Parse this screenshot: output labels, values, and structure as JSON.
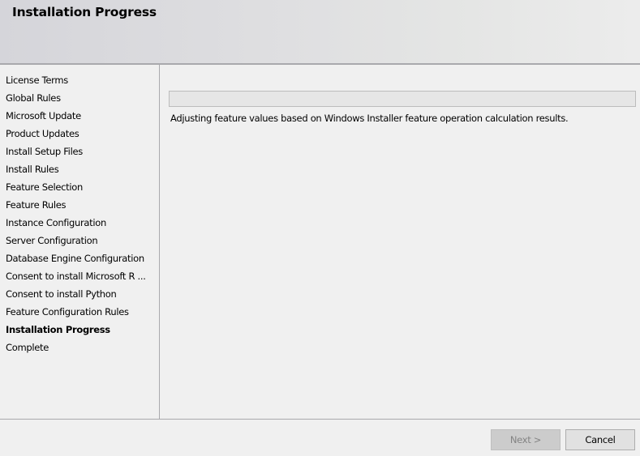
{
  "header": {
    "title": "Installation Progress"
  },
  "sidebar": {
    "items": [
      {
        "label": "License Terms",
        "active": false
      },
      {
        "label": "Global Rules",
        "active": false
      },
      {
        "label": "Microsoft Update",
        "active": false
      },
      {
        "label": "Product Updates",
        "active": false
      },
      {
        "label": "Install Setup Files",
        "active": false
      },
      {
        "label": "Install Rules",
        "active": false
      },
      {
        "label": "Feature Selection",
        "active": false
      },
      {
        "label": "Feature Rules",
        "active": false
      },
      {
        "label": "Instance Configuration",
        "active": false
      },
      {
        "label": "Server Configuration",
        "active": false
      },
      {
        "label": "Database Engine Configuration",
        "active": false
      },
      {
        "label": "Consent to install Microsoft R ...",
        "active": false
      },
      {
        "label": "Consent to install Python",
        "active": false
      },
      {
        "label": "Feature Configuration Rules",
        "active": false
      },
      {
        "label": "Installation Progress",
        "active": true
      },
      {
        "label": "Complete",
        "active": false
      }
    ]
  },
  "main": {
    "progress_percent": 0,
    "status_text": "Adjusting feature values based on Windows Installer feature operation calculation results."
  },
  "footer": {
    "next_label": "Next >",
    "next_enabled": false,
    "cancel_label": "Cancel"
  }
}
